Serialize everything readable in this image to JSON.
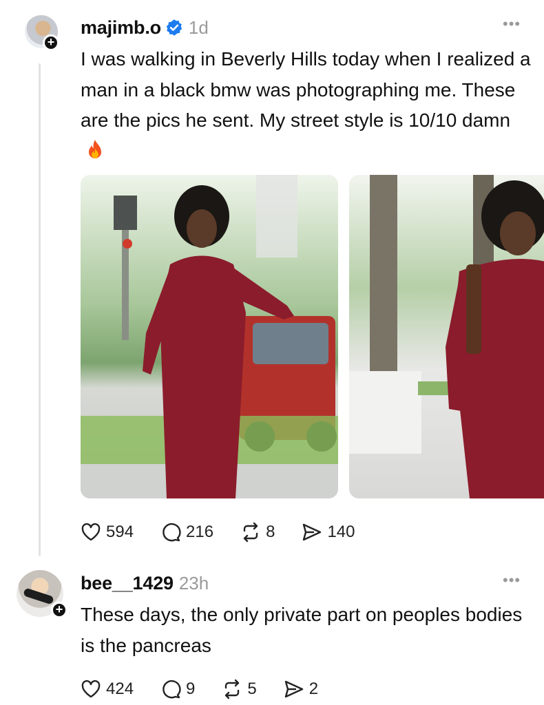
{
  "post": {
    "username": "majimb.o",
    "time": "1d",
    "text": "I was walking in Beverly Hills today when I realized a man in a black bmw was photographing me. These are the pics he sent. My street style is 10/10 damn",
    "icons": [
      "verified-badge-icon",
      "flame-emoji-icon",
      "more-options-icon"
    ],
    "accent_color": "#1d7bf0",
    "stats": {
      "likes": "594",
      "comments": "216",
      "reposts": "8",
      "shares": "140"
    }
  },
  "reply": {
    "username": "bee__1429",
    "time": "23h",
    "text": "These days, the only private part on peoples bodies is the pancreas",
    "stats": {
      "likes": "424",
      "comments": "9",
      "reposts": "5",
      "shares": "2"
    }
  }
}
